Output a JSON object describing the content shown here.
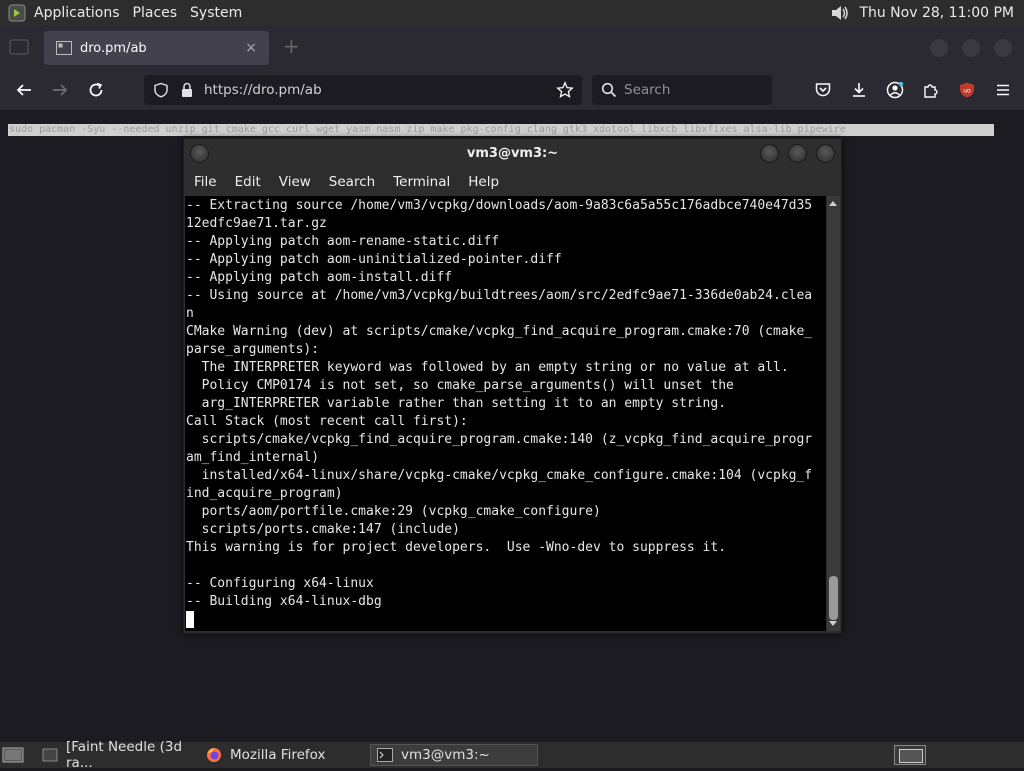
{
  "top_panel": {
    "menus": [
      "Applications",
      "Places",
      "System"
    ],
    "clock": "Thu Nov 28, 11:00 PM"
  },
  "browser": {
    "tab_title": "dro.pm/ab",
    "tab_close": "×",
    "new_tab": "+",
    "url": "https://dro.pm/ab",
    "search_placeholder": "Search",
    "page_selected_text": "sudo pacman -Syu --needed unzip git cmake gcc curl wget yasm nasm zip make pkg-config clang gtk3 xdotool libxcb libxfixes alsa-lib pipewire"
  },
  "terminal": {
    "title": "vm3@vm3:~",
    "menus": [
      "File",
      "Edit",
      "View",
      "Search",
      "Terminal",
      "Help"
    ],
    "lines": [
      "-- Extracting source /home/vm3/vcpkg/downloads/aom-9a83c6a5a55c176adbce740e47d35",
      "12edfc9ae71.tar.gz",
      "-- Applying patch aom-rename-static.diff",
      "-- Applying patch aom-uninitialized-pointer.diff",
      "-- Applying patch aom-install.diff",
      "-- Using source at /home/vm3/vcpkg/buildtrees/aom/src/2edfc9ae71-336de0ab24.clea",
      "n",
      "CMake Warning (dev) at scripts/cmake/vcpkg_find_acquire_program.cmake:70 (cmake_",
      "parse_arguments):",
      "  The INTERPRETER keyword was followed by an empty string or no value at all.",
      "  Policy CMP0174 is not set, so cmake_parse_arguments() will unset the",
      "  arg_INTERPRETER variable rather than setting it to an empty string.",
      "Call Stack (most recent call first):",
      "  scripts/cmake/vcpkg_find_acquire_program.cmake:140 (z_vcpkg_find_acquire_progr",
      "am_find_internal)",
      "  installed/x64-linux/share/vcpkg-cmake/vcpkg_cmake_configure.cmake:104 (vcpkg_f",
      "ind_acquire_program)",
      "  ports/aom/portfile.cmake:29 (vcpkg_cmake_configure)",
      "  scripts/ports.cmake:147 (include)",
      "This warning is for project developers.  Use -Wno-dev to suppress it.",
      "",
      "-- Configuring x64-linux",
      "-- Building x64-linux-dbg"
    ]
  },
  "taskbar": {
    "tasks": [
      "[Faint Needle (3d ra...",
      "Mozilla Firefox",
      "vm3@vm3:~"
    ]
  },
  "colors": {
    "panel": "#2d2d2d",
    "browser_chrome": "#2b2a33",
    "terminal_bg": "#000000",
    "ublock_red": "#c0392b"
  }
}
